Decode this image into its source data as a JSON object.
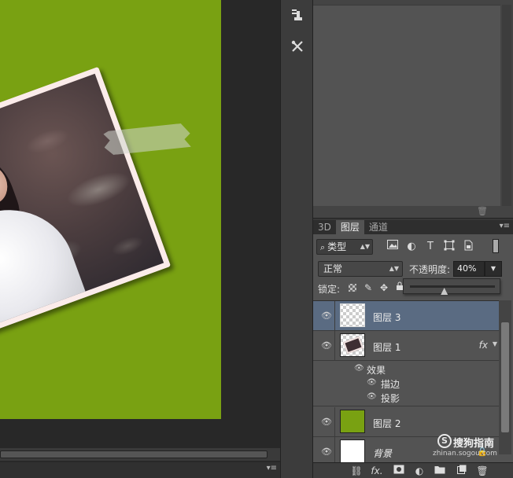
{
  "colors": {
    "canvas_fill": "#79a112",
    "selected_layer": "#5a6b82",
    "panel_bg": "#535353"
  },
  "tool_dock": {
    "items": [
      {
        "icon": "clone-source-icon"
      },
      {
        "icon": "tool-presets-icon"
      }
    ]
  },
  "upper_panel": {
    "trash_icon": "trash-icon"
  },
  "tabs": [
    {
      "label": "3D",
      "active": false
    },
    {
      "label": "图层",
      "active": true
    },
    {
      "label": "通道",
      "active": false
    }
  ],
  "panel_menu_glyph": "▾≡",
  "filter": {
    "kind_label": "类型",
    "search_glyph": "⌕",
    "icons": [
      "image-filter-icon",
      "adjustment-filter-icon",
      "type-filter-icon",
      "shape-filter-icon",
      "smart-object-filter-icon"
    ],
    "type_glyph": "T"
  },
  "blend": {
    "mode": "正常",
    "opacity_label": "不透明度:",
    "opacity_value": "40%",
    "opacity_fraction": 0.4
  },
  "lock": {
    "label": "锁定:"
  },
  "layers": [
    {
      "name": "图层 3",
      "thumb": "transparent",
      "selected": true,
      "visible": true
    },
    {
      "name": "图层 1",
      "thumb": "photo",
      "selected": false,
      "visible": true,
      "fx": "fx",
      "effects_label": "效果",
      "effects": [
        "描边",
        "投影"
      ]
    },
    {
      "name": "图层 2",
      "thumb": "green",
      "selected": false,
      "visible": true
    },
    {
      "name": "背景",
      "thumb": "white",
      "selected": false,
      "visible": true,
      "locked": true
    }
  ],
  "bottom_bar": {
    "fx_label": "fx."
  },
  "watermark": {
    "logo": "S",
    "text": "搜狗指南",
    "url": "zhinan.sogou.com"
  }
}
